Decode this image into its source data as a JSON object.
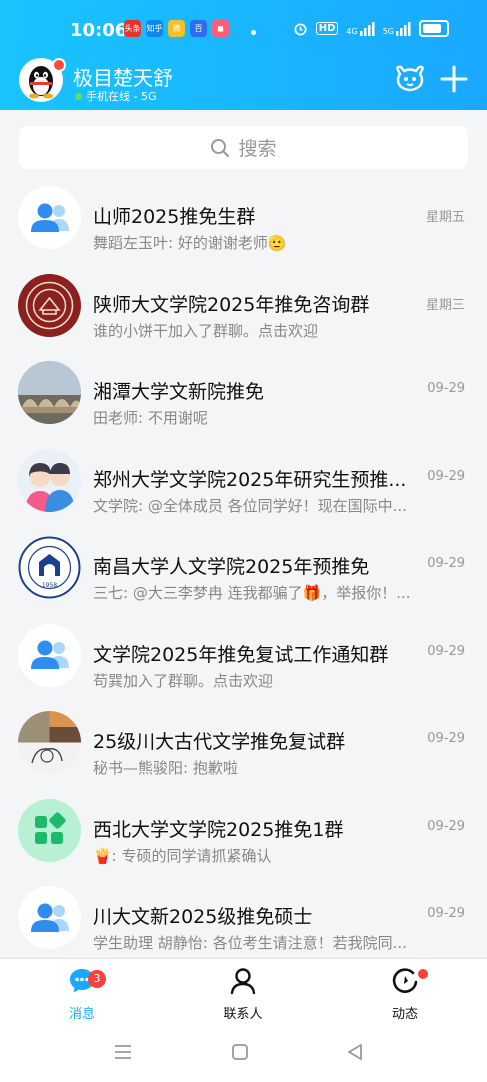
{
  "status_bar": {
    "time": "10:06",
    "apps": [
      {
        "name": "toutiao-icon",
        "color": "#e8312b",
        "text": "头条"
      },
      {
        "name": "zhihu-icon",
        "color": "#0f88eb",
        "text": "知乎"
      },
      {
        "name": "weibo-icon",
        "color": "#f6c026",
        "text": "微"
      },
      {
        "name": "baidu-icon",
        "color": "#2b6ef3",
        "text": "百"
      },
      {
        "name": "app-icon",
        "color": "#ff5d7a",
        "text": "◼"
      }
    ],
    "hd": "HD",
    "net1": "4G",
    "net2": "5G"
  },
  "header": {
    "username": "极目楚天舒",
    "status": "手机在线 - 5G"
  },
  "search": {
    "placeholder": "搜索"
  },
  "chats": [
    {
      "name": "山师2025推免生群",
      "time": "星期五",
      "msg": "舞蹈左玉叶: 好的谢谢老师🫡",
      "avatar": "group"
    },
    {
      "name": "陕师大文学院2025年推免咨询群",
      "time": "星期三",
      "msg": "谁的小饼干加入了群聊。点击欢迎",
      "avatar": "seal"
    },
    {
      "name": "湘潭大学文新院推免",
      "time": "09-29",
      "msg": "田老师: 不用谢呢",
      "avatar": "photo"
    },
    {
      "name": "郑州大学文学院2025年研究生预推...",
      "time": "09-29",
      "msg": "文学院: @全体成员 各位同学好！现在国际中...",
      "avatar": "people"
    },
    {
      "name": "南昌大学人文学院2025年预推免",
      "time": "09-29",
      "msg": "三七: @大三李梦冉 连我都骗了🎁，举报你！...",
      "avatar": "logo"
    },
    {
      "name": "文学院2025年推免复试工作通知群",
      "time": "09-29",
      "msg": "苟巽加入了群聊。点击欢迎",
      "avatar": "group"
    },
    {
      "name": "25级川大古代文学推免复试群",
      "time": "09-29",
      "msg": "秘书—熊骏阳: 抱歉啦",
      "avatar": "mosaic"
    },
    {
      "name": "西北大学文学院2025推免1群",
      "time": "09-29",
      "msg": "🍟: 专硕的同学请抓紧确认",
      "avatar": "apps"
    },
    {
      "name": "川大文新2025级推免硕士",
      "time": "09-29",
      "msg": "学生助理 胡静怡: 各位考生请注意！若我院同...",
      "avatar": "group"
    }
  ],
  "tabs": [
    {
      "label": "消息",
      "badge": "3",
      "active": true
    },
    {
      "label": "联系人"
    },
    {
      "label": "动态"
    }
  ],
  "colors": {
    "accent": "#1aa8ff",
    "badge": "#f5423c"
  }
}
